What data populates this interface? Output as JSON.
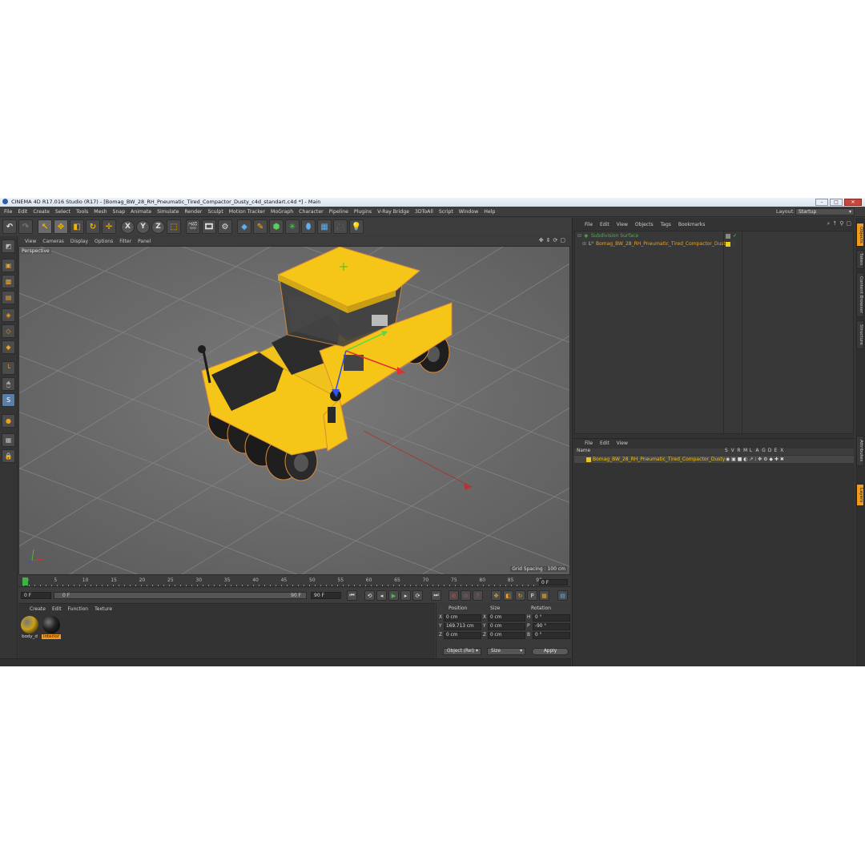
{
  "window": {
    "title": "CINEMA 4D R17.016 Studio (R17) - [Bomag_BW_28_RH_Pneumatic_Tired_Compactor_Dusty_c4d_standart.c4d *] - Main",
    "controls": [
      "minimize-icon",
      "maximize-icon",
      "close-icon"
    ]
  },
  "menubar": {
    "items": [
      "File",
      "Edit",
      "Create",
      "Select",
      "Tools",
      "Mesh",
      "Snap",
      "Animate",
      "Simulate",
      "Render",
      "Sculpt",
      "Motion Tracker",
      "MoGraph",
      "Character",
      "Pipeline",
      "Plugins",
      "V-Ray Bridge",
      "3DToAll",
      "Script",
      "Window",
      "Help"
    ],
    "layout_label": "Layout:",
    "layout_value": "Startup"
  },
  "toolbar": {
    "axes": [
      "X",
      "Y",
      "Z"
    ]
  },
  "viewport": {
    "menu": [
      "View",
      "Cameras",
      "Display",
      "Options",
      "Filter",
      "Panel"
    ],
    "label": "Perspective",
    "grid_spacing": "Grid Spacing : 100 cm"
  },
  "timeline": {
    "ticks": [
      "0",
      "5",
      "10",
      "15",
      "20",
      "25",
      "30",
      "35",
      "40",
      "45",
      "50",
      "55",
      "60",
      "65",
      "70",
      "75",
      "80",
      "85",
      "90"
    ],
    "current_frame": "0 F",
    "start_field": "0 F",
    "slider_start": "0 F",
    "slider_end": "90 F",
    "end_field": "90 F"
  },
  "materials": {
    "menu": [
      "Create",
      "Edit",
      "Function",
      "Texture"
    ],
    "items": [
      {
        "name": "body_d",
        "selected": false,
        "color": "#c9a21c"
      },
      {
        "name": "interior",
        "selected": true,
        "color": "#222222"
      }
    ]
  },
  "coordinates": {
    "headers": [
      "Position",
      "Size",
      "Rotation"
    ],
    "rows": [
      {
        "axis": "X",
        "position": "0 cm",
        "size_axis": "X",
        "size": "0 cm",
        "rot_axis": "H",
        "rotation": "0 °"
      },
      {
        "axis": "Y",
        "position": "169.713 cm",
        "size_axis": "Y",
        "size": "0 cm",
        "rot_axis": "P",
        "rotation": "-90 °"
      },
      {
        "axis": "Z",
        "position": "0 cm",
        "size_axis": "Z",
        "size": "0 cm",
        "rot_axis": "B",
        "rotation": "0 °"
      }
    ],
    "mode_dropdown": "Object (Rel)",
    "size_dropdown": "Size",
    "apply_label": "Apply"
  },
  "object_manager": {
    "menu": [
      "File",
      "Edit",
      "View",
      "Objects",
      "Tags",
      "Bookmarks"
    ],
    "objects": [
      {
        "name": "Subdivision Surface",
        "color": "#4caf50"
      },
      {
        "name": "Bomag_BW_28_RH_Pneumatic_Tired_Compactor_Dusty",
        "color": "#f0a21d"
      }
    ]
  },
  "layer_manager": {
    "menu": [
      "File",
      "Edit",
      "View"
    ],
    "headers": [
      "Name",
      "S",
      "V",
      "R",
      "M",
      "L",
      "A",
      "G",
      "D",
      "E",
      "X"
    ],
    "layer": {
      "name": "Bomag_BW_28_RH_Pneumatic_Tired_Compactor_Dusty",
      "color": "#f0c21d"
    }
  },
  "side_tabs": [
    "Objects",
    "Takes",
    "Content Browser",
    "Structure",
    "Attributes",
    "Layers"
  ],
  "colors": {
    "accent": "#f29a1d",
    "machine_yellow": "#f5c518",
    "viewport_bg": "#6e6e6e"
  }
}
